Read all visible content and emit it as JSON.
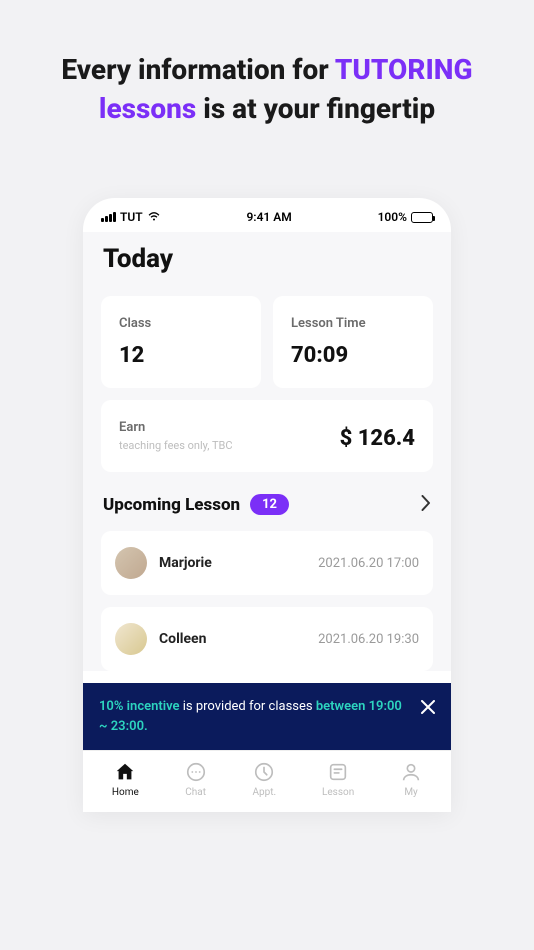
{
  "hero": {
    "line1_pre": "Every information for ",
    "line1_accent": "TUTORING",
    "line2_accent": "lessons",
    "line2_post": " is at your fingertip"
  },
  "status": {
    "carrier": "TUT",
    "time": "9:41 AM",
    "battery": "100%"
  },
  "page": {
    "title": "Today"
  },
  "stats": {
    "class_label": "Class",
    "class_value": "12",
    "lesson_time_label": "Lesson Time",
    "lesson_time_value": "70:09",
    "earn_label": "Earn",
    "earn_sub": "teaching fees only, TBC",
    "earn_value": "$ 126.4"
  },
  "upcoming": {
    "title": "Upcoming Lesson",
    "count": "12",
    "items": [
      {
        "name": "Marjorie",
        "time": "2021.06.20 17:00"
      },
      {
        "name": "Colleen",
        "time": "2021.06.20 19:30"
      }
    ]
  },
  "banner": {
    "part1": "10% incentive",
    "part2": " is provided for classes ",
    "part3": "between 19:00 ~ 23:00."
  },
  "tabs": {
    "home": "Home",
    "chat": "Chat",
    "appt": "Appt.",
    "lesson": "Lesson",
    "my": "My"
  }
}
